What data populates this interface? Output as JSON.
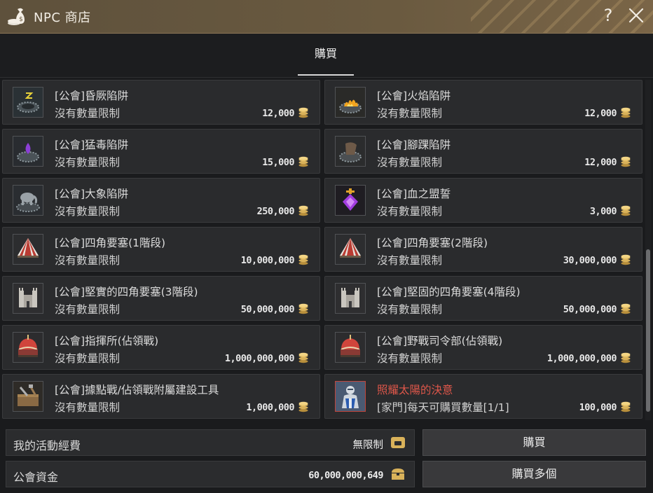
{
  "window": {
    "title": "NPC 商店",
    "help_label": "?",
    "icon": "money-bag-icon"
  },
  "tabs": [
    {
      "label": "購買",
      "active": true
    }
  ],
  "items": [
    {
      "name": "[公會]昏厥陷阱",
      "limit": "沒有數量限制",
      "price": "12,000",
      "icon": "stun-trap-icon"
    },
    {
      "name": "[公會]火焰陷阱",
      "limit": "沒有數量限制",
      "price": "12,000",
      "icon": "fire-trap-icon"
    },
    {
      "name": "[公會]猛毒陷阱",
      "limit": "沒有數量限制",
      "price": "15,000",
      "icon": "poison-trap-icon"
    },
    {
      "name": "[公會]腳踝陷阱",
      "limit": "沒有數量限制",
      "price": "12,000",
      "icon": "ankle-trap-icon"
    },
    {
      "name": "[公會]大象陷阱",
      "limit": "沒有數量限制",
      "price": "250,000",
      "icon": "elephant-trap-icon"
    },
    {
      "name": "[公會]血之盟誓",
      "limit": "沒有數量限制",
      "price": "3,000",
      "icon": "blood-oath-icon"
    },
    {
      "name": "[公會]四角要塞(1階段)",
      "limit": "沒有數量限制",
      "price": "10,000,000",
      "icon": "tent-fortress-icon"
    },
    {
      "name": "[公會]四角要塞(2階段)",
      "limit": "沒有數量限制",
      "price": "30,000,000",
      "icon": "tent-fortress-icon"
    },
    {
      "name": "[公會]堅實的四角要塞(3階段)",
      "limit": "沒有數量限制",
      "price": "50,000,000",
      "icon": "stone-fortress-icon"
    },
    {
      "name": "[公會]堅固的四角要塞(4階段)",
      "limit": "沒有數量限制",
      "price": "50,000,000",
      "icon": "stone-fortress-icon"
    },
    {
      "name": "[公會]指揮所(佔領戰)",
      "limit": "沒有數量限制",
      "price": "1,000,000,000",
      "icon": "command-post-icon"
    },
    {
      "name": "[公會]野戰司令部(佔領戰)",
      "limit": "沒有數量限制",
      "price": "1,000,000,000",
      "icon": "command-post-icon"
    },
    {
      "name": "[公會]據點戰/佔領戰附屬建設工具",
      "limit": "沒有數量限制",
      "price": "1,000,000",
      "icon": "toolbox-icon"
    },
    {
      "name": "照耀太陽的決意",
      "limit": "[家門]每天可購買數量[1/1]",
      "price": "100,000",
      "icon": "armored-knight-icon",
      "special": true
    }
  ],
  "colors": {
    "special_name": "#e0574a",
    "coin": "#d9b25a",
    "title_bar": "#6a5a40"
  },
  "funds": {
    "activity_label": "我的活動經費",
    "activity_value": "無限制",
    "guild_label": "公會資金",
    "guild_value": "60,000,000,649"
  },
  "buttons": {
    "buy": "購買",
    "buy_multiple": "購買多個"
  }
}
